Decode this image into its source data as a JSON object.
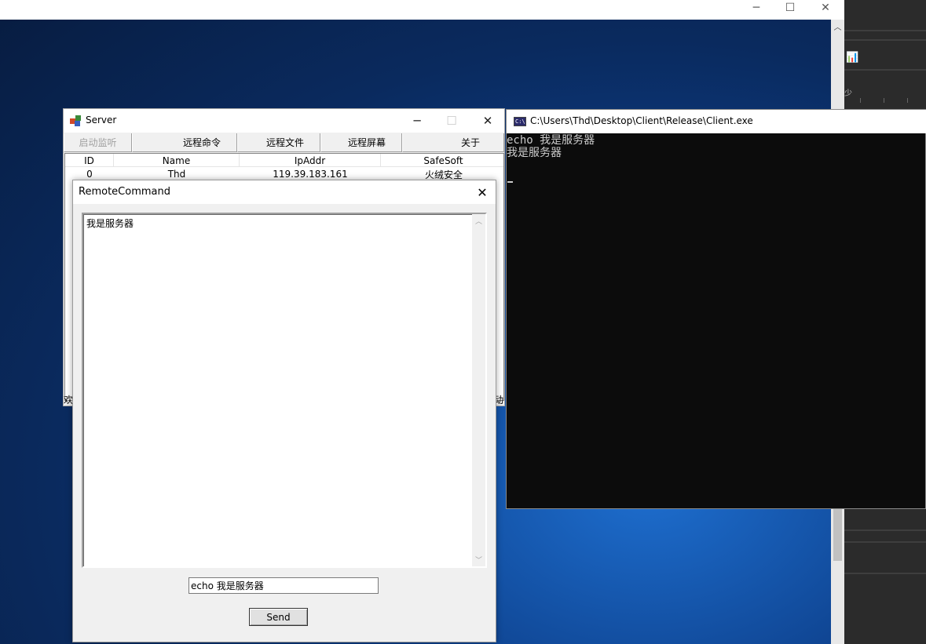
{
  "background_window": {
    "controls": {
      "minimize": "─",
      "maximize": "☐",
      "close": "✕"
    },
    "scroll_up": "︿"
  },
  "right_panel": {
    "icon_text": "📊",
    "partial_char": "少"
  },
  "server_window": {
    "title": "Server",
    "controls": {
      "minimize": "─",
      "maximize": "☐",
      "close": "✕"
    },
    "toolbar": [
      "启动监听",
      "远程命令",
      "远程文件",
      "远程屏幕",
      "关于"
    ],
    "columns": [
      "ID",
      "Name",
      "IpAddr",
      "SafeSoft"
    ],
    "rows": [
      {
        "id": "0",
        "name": "Thd",
        "ip": "119.39.183.161",
        "safesoft": "火绒安全"
      }
    ],
    "status_left": "欢",
    "status_right": "动"
  },
  "remote_command": {
    "title": "RemoteCommand",
    "close": "✕",
    "output": "我是服务器",
    "input_value": "echo 我是服务器",
    "send_label": "Send",
    "scroll_up": "︿",
    "scroll_down": "﹀"
  },
  "console_window": {
    "icon_text": "C:\\",
    "title": "C:\\Users\\Thd\\Desktop\\Client\\Release\\Client.exe",
    "lines": [
      "echo 我是服务器",
      "我是服务器"
    ],
    "colors": {
      "background": "#0c0c0c",
      "text": "#cccccc"
    }
  }
}
